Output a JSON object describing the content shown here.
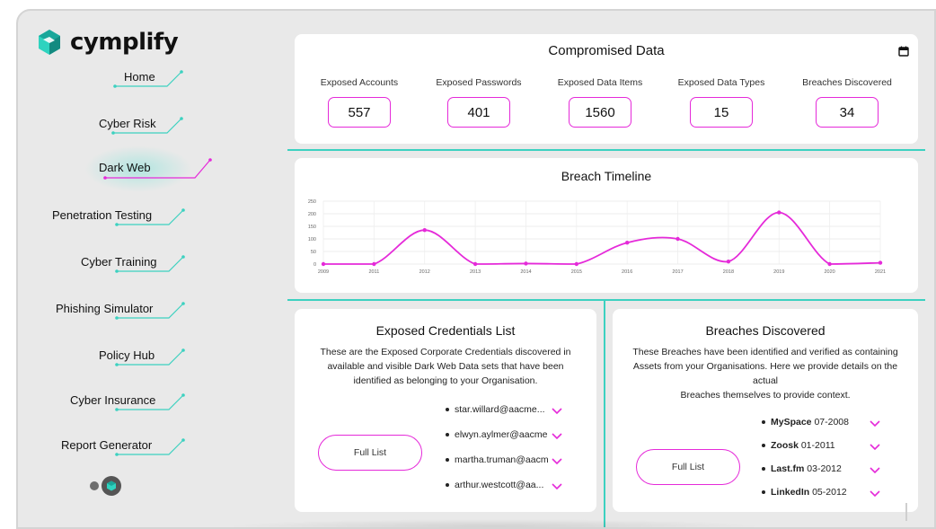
{
  "brand": {
    "name": "cymplify"
  },
  "sidebar": {
    "items": [
      {
        "label": "Home"
      },
      {
        "label": "Cyber Risk"
      },
      {
        "label": "Dark Web",
        "active": true
      },
      {
        "label": "Penetration Testing"
      },
      {
        "label": "Cyber Training"
      },
      {
        "label": "Phishing Simulator"
      },
      {
        "label": "Policy Hub"
      },
      {
        "label": "Cyber Insurance"
      },
      {
        "label": "Report Generator"
      }
    ]
  },
  "compromised": {
    "title": "Compromised Data",
    "stats": [
      {
        "label": "Exposed Accounts",
        "value": "557"
      },
      {
        "label": "Exposed Passwords",
        "value": "401"
      },
      {
        "label": "Exposed Data Items",
        "value": "1560"
      },
      {
        "label": "Exposed Data Types",
        "value": "15"
      },
      {
        "label": "Breaches Discovered",
        "value": "34"
      }
    ]
  },
  "timeline": {
    "title": "Breach Timeline"
  },
  "chart_data": {
    "type": "line",
    "title": "Breach Timeline",
    "categories": [
      "2009",
      "2011",
      "2012",
      "2013",
      "2014",
      "2015",
      "2016",
      "2017",
      "2018",
      "2019",
      "2020",
      "2021"
    ],
    "values": [
      0,
      0,
      135,
      0,
      2,
      0,
      85,
      100,
      10,
      205,
      0,
      5
    ],
    "ylim": [
      0,
      250
    ],
    "yticks": [
      "250",
      "200",
      "150",
      "100",
      "50",
      "0"
    ],
    "grid": true,
    "color": "#e52ad9"
  },
  "credentials": {
    "title": "Exposed Credentials List",
    "description": [
      "These are the Exposed Corporate Credentials discovered in",
      "available and visible Dark Web Data sets that have been",
      "identified as belonging to your Organisation."
    ],
    "button": "Full List",
    "items": [
      "star.willard@aacme...",
      "elwyn.aylmer@aacme",
      "martha.truman@aacm",
      "arthur.westcott@aa..."
    ]
  },
  "breaches": {
    "title": "Breaches Discovered",
    "description": [
      "These Breaches have been identified and verified as containing",
      "Assets from your Organisations. Here we provide details on the",
      "actual",
      "Breaches themselves to provide context."
    ],
    "button": "Full List",
    "items": [
      {
        "name": "MySpace",
        "date": "07-2008"
      },
      {
        "name": "Zoosk",
        "date": "01-2011"
      },
      {
        "name": "Last.fm",
        "date": "03-2012"
      },
      {
        "name": "LinkedIn",
        "date": "05-2012"
      }
    ]
  },
  "colors": {
    "accent": "#e52ad9",
    "teal": "#3cd1c0",
    "background": "#e9e9e9"
  },
  "icons": [
    "cymplify-logo-icon",
    "calendar-icon",
    "chevron-down-icon",
    "theme-toggle-icon"
  ]
}
